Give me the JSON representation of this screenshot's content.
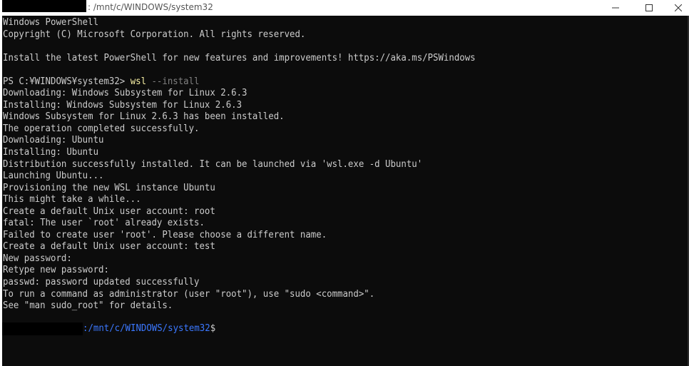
{
  "window": {
    "title": ": /mnt/c/WINDOWS/system32",
    "controls": {
      "minimize_icon": "minimize-icon",
      "maximize_icon": "maximize-icon",
      "close_icon": "close-icon"
    }
  },
  "colors": {
    "background": "#0c0c0c",
    "text": "#cccccc",
    "command": "#f9f1a5",
    "parameter": "#808080",
    "path": "#3b78ff"
  },
  "terminal": {
    "lines": [
      "Windows PowerShell",
      "Copyright (C) Microsoft Corporation. All rights reserved.",
      "",
      "Install the latest PowerShell for new features and improvements! https://aka.ms/PSWindows",
      "",
      "",
      "Downloading: Windows Subsystem for Linux 2.6.3",
      "Installing: Windows Subsystem for Linux 2.6.3",
      "Windows Subsystem for Linux 2.6.3 has been installed.",
      "The operation completed successfully.",
      "Downloading: Ubuntu",
      "Installing: Ubuntu",
      "Distribution successfully installed. It can be launched via 'wsl.exe -d Ubuntu'",
      "Launching Ubuntu...",
      "Provisioning the new WSL instance Ubuntu",
      "This might take a while...",
      "Create a default Unix user account: root",
      "fatal: The user `root' already exists.",
      "Failed to create user 'root'. Please choose a different name.",
      "Create a default Unix user account: test",
      "New password:",
      "Retype new password:",
      "passwd: password updated successfully",
      "To run a command as administrator (user \"root\"), use \"sudo <command>\".",
      "See \"man sudo_root\" for details."
    ],
    "ps_prompt": "PS C:¥WINDOWS¥system32> ",
    "ps_command": "wsl",
    "ps_args": " --install",
    "bash_path": ":/mnt/c/WINDOWS/system32",
    "bash_symbol": "$"
  }
}
